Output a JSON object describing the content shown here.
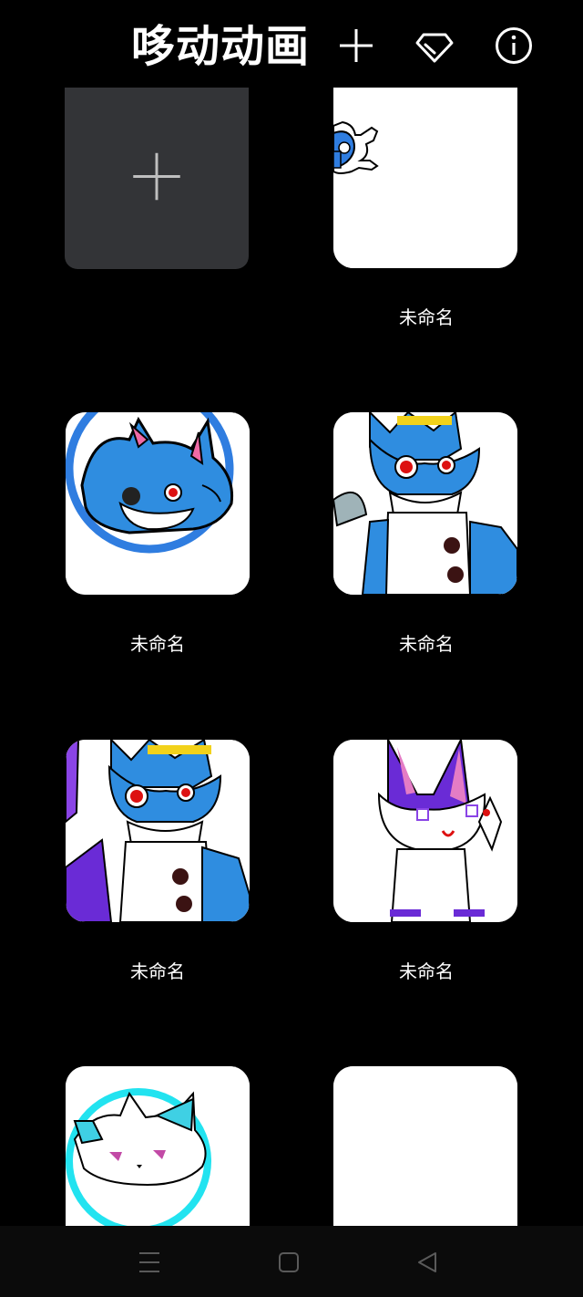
{
  "header": {
    "title": "哆动动画",
    "add_icon": "plus-icon",
    "gem_icon": "diamond-icon",
    "info_icon": "info-icon"
  },
  "grid": {
    "new_card_icon": "plus-icon",
    "items": [
      {
        "label": "未命名",
        "thumb": "blue-creature-corner"
      },
      {
        "label": "未命名",
        "thumb": "blue-fox-circle"
      },
      {
        "label": "未命名",
        "thumb": "blue-fox-full-body"
      },
      {
        "label": "未命名",
        "thumb": "blue-fox-full-body-purple"
      },
      {
        "label": "未命名",
        "thumb": "white-purple-fox"
      },
      {
        "label": "",
        "thumb": "white-cyan-fox-circle"
      },
      {
        "label": "",
        "thumb": "blank"
      }
    ]
  },
  "navbar": {
    "menu_icon": "menu-icon",
    "home_icon": "square-icon",
    "back_icon": "triangle-back-icon"
  },
  "colors": {
    "background": "#000000",
    "card_new": "#333437",
    "blue_fox": "#2f8de0",
    "purple_fox": "#6a2bd6",
    "cyan_ring": "#22e3f0"
  }
}
